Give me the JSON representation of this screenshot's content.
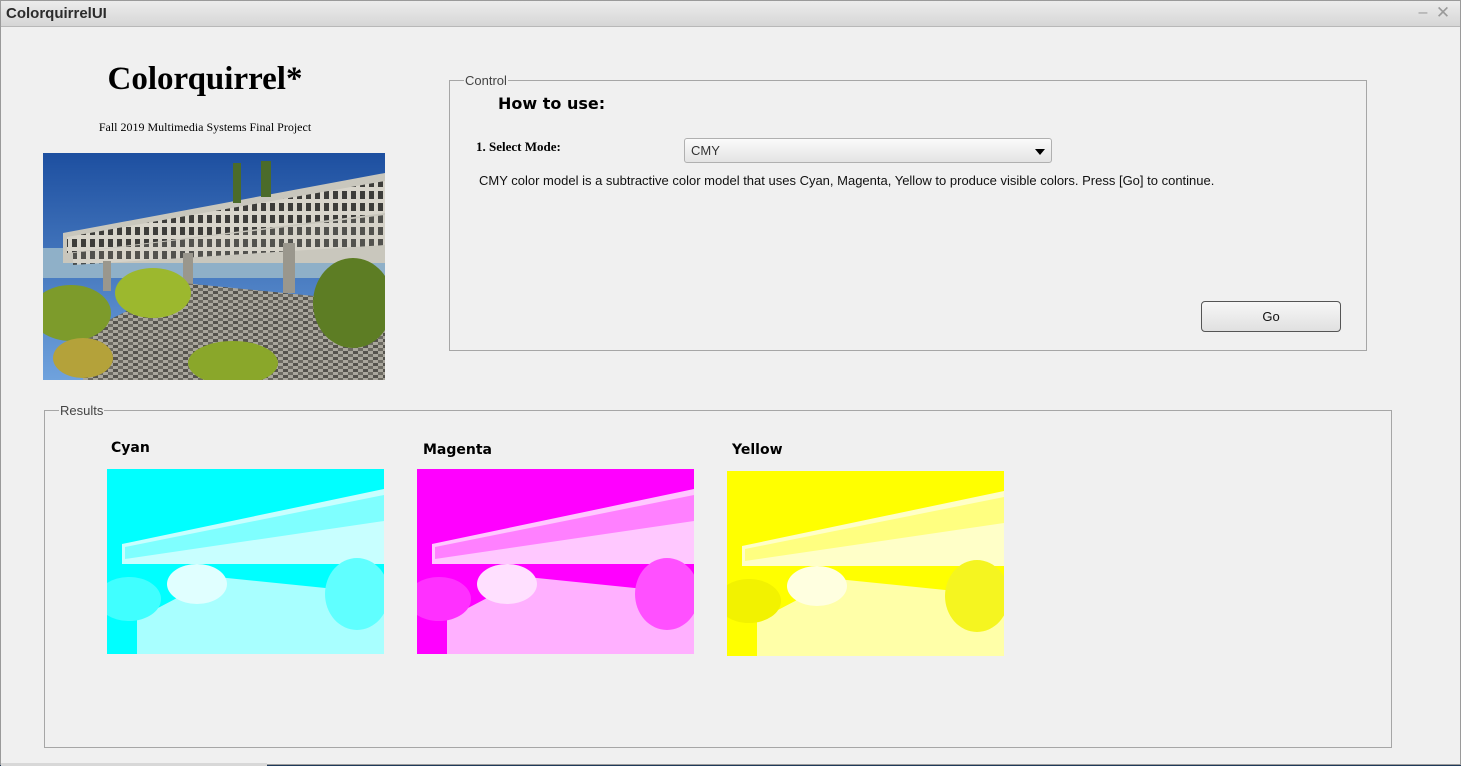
{
  "window": {
    "title": "ColorquirrelUI",
    "minimize_glyph": "–",
    "close_glyph": "✕"
  },
  "header": {
    "app_title": "Colorquirrel*",
    "subtitle": "Fall 2019 Multimedia Systems Final Project"
  },
  "control": {
    "legend": "Control",
    "how_to_title": "How to use:",
    "select_label": "1. Select Mode:",
    "mode_selected": "CMY",
    "description": "CMY color model is a subtractive color model that uses Cyan, Magenta, Yellow to produce visible colors. Press [Go] to continue.",
    "go_label": "Go"
  },
  "results": {
    "legend": "Results",
    "channels": [
      {
        "label": "Cyan",
        "tint": "#00ffff"
      },
      {
        "label": "Magenta",
        "tint": "#ff00ff"
      },
      {
        "label": "Yellow",
        "tint": "#ffff00"
      }
    ]
  },
  "colors": {
    "window_bg": "#f0f0f0",
    "sky": "#2f63b4",
    "building": "#c9c7bd",
    "foliage": "#6e8f2a",
    "cyan": "#00ffff",
    "magenta": "#ff00ff",
    "yellow": "#ffff00"
  },
  "icons": {
    "minimize": "minimize-icon",
    "close": "close-icon",
    "dropdown": "chevron-down-icon"
  }
}
